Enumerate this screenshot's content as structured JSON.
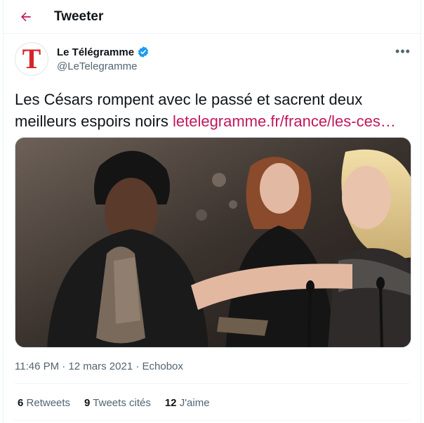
{
  "header": {
    "title": "Tweeter"
  },
  "author": {
    "name": "Le Télégramme",
    "handle": "@LeTelegramme",
    "avatar_letter": "T",
    "verified": true
  },
  "tweet": {
    "text": "Les Césars rompent avec le passé et sacrent deux meilleurs espoirs noirs ",
    "link": "letelegramme.fr/france/les-ces…"
  },
  "meta": {
    "time": "11:46 PM",
    "date": "12 mars 2021",
    "source": "Echobox",
    "separator": "·"
  },
  "stats": [
    {
      "count": "6",
      "label": "Retweets"
    },
    {
      "count": "9",
      "label": "Tweets cités"
    },
    {
      "count": "12",
      "label": "J'aime"
    }
  ],
  "colors": {
    "accent": "#c2185b",
    "verified": "#1d9bf0",
    "brand_red": "#d8232a",
    "muted": "#536471"
  }
}
